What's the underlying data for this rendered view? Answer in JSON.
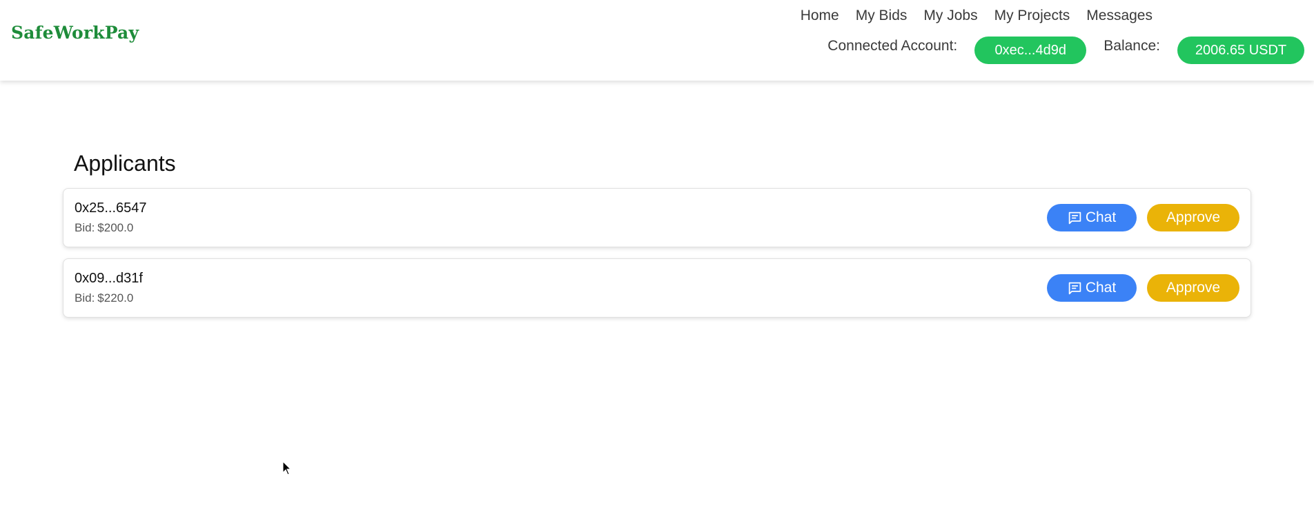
{
  "brand": {
    "name": "SafeWorkPay",
    "color": "#1e8c3a"
  },
  "nav": {
    "items": [
      {
        "label": "Home"
      },
      {
        "label": "My Bids"
      },
      {
        "label": "My Jobs"
      },
      {
        "label": "My Projects"
      },
      {
        "label": "Messages"
      }
    ]
  },
  "account": {
    "connected_label": "Connected Account:",
    "connected_value": "0xec...4d9d",
    "balance_label": "Balance:",
    "balance_value": "2006.65 USDT",
    "pill_color": "#22c55e"
  },
  "main": {
    "title": "Applicants",
    "applicants": [
      {
        "address": "0x25...6547",
        "bid_label": "Bid:",
        "bid_amount": "$200.0",
        "chat_label": "Chat",
        "approve_label": "Approve"
      },
      {
        "address": "0x09...d31f",
        "bid_label": "Bid:",
        "bid_amount": "$220.0",
        "chat_label": "Chat",
        "approve_label": "Approve"
      }
    ]
  },
  "colors": {
    "chat_button": "#3b82f6",
    "approve_button": "#eab308"
  },
  "icons": {
    "chat": "message-square-icon",
    "cursor": "mouse-pointer-icon"
  }
}
